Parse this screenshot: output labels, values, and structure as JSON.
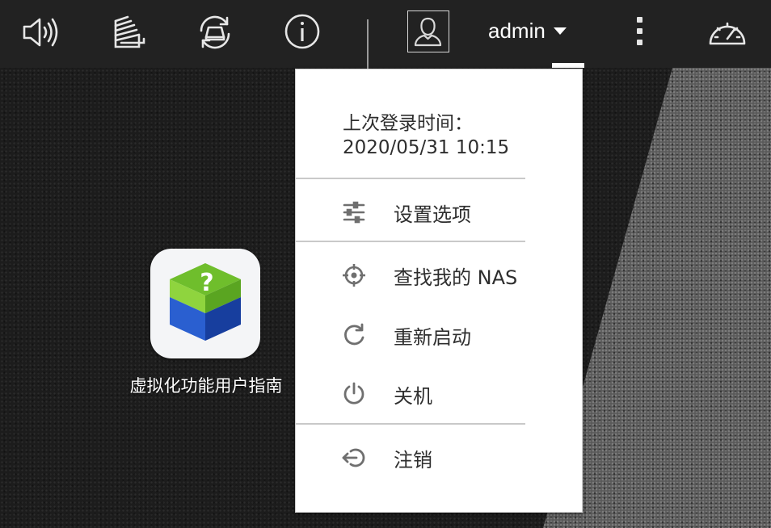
{
  "topbar": {
    "icons": {
      "volume": "volume-icon",
      "stack": "tasks-icon",
      "sync": "sync-icon",
      "info": "info-icon",
      "more": "more-vertical-icon",
      "dashboard": "dashboard-gauge-icon"
    },
    "avatar": "user-avatar-icon",
    "username": "admin"
  },
  "dropdown": {
    "last_login_label": "上次登录时间：",
    "last_login_value": "2020/05/31 10:15",
    "items": [
      {
        "label": "设置选项",
        "icon": "settings-sliders-icon"
      },
      {
        "label": "查找我的 NAS",
        "icon": "locate-crosshair-icon"
      },
      {
        "label": "重新启动",
        "icon": "restart-icon"
      },
      {
        "label": "关机",
        "icon": "power-icon"
      },
      {
        "label": "注销",
        "icon": "logout-icon"
      }
    ]
  },
  "desktop": {
    "apps": [
      {
        "label": "虚拟化功能用户指南",
        "icon": "virtualization-guide-cube-icon"
      }
    ]
  },
  "colors": {
    "topbar_bg": "#222222",
    "desktop_bg": "#1c1c1c",
    "menu_bg": "#ffffff",
    "menu_text": "#2e2e2e",
    "menu_icon": "#6f6f6f",
    "cube_green": "#6fbe2c",
    "cube_blue": "#1d47b4"
  }
}
